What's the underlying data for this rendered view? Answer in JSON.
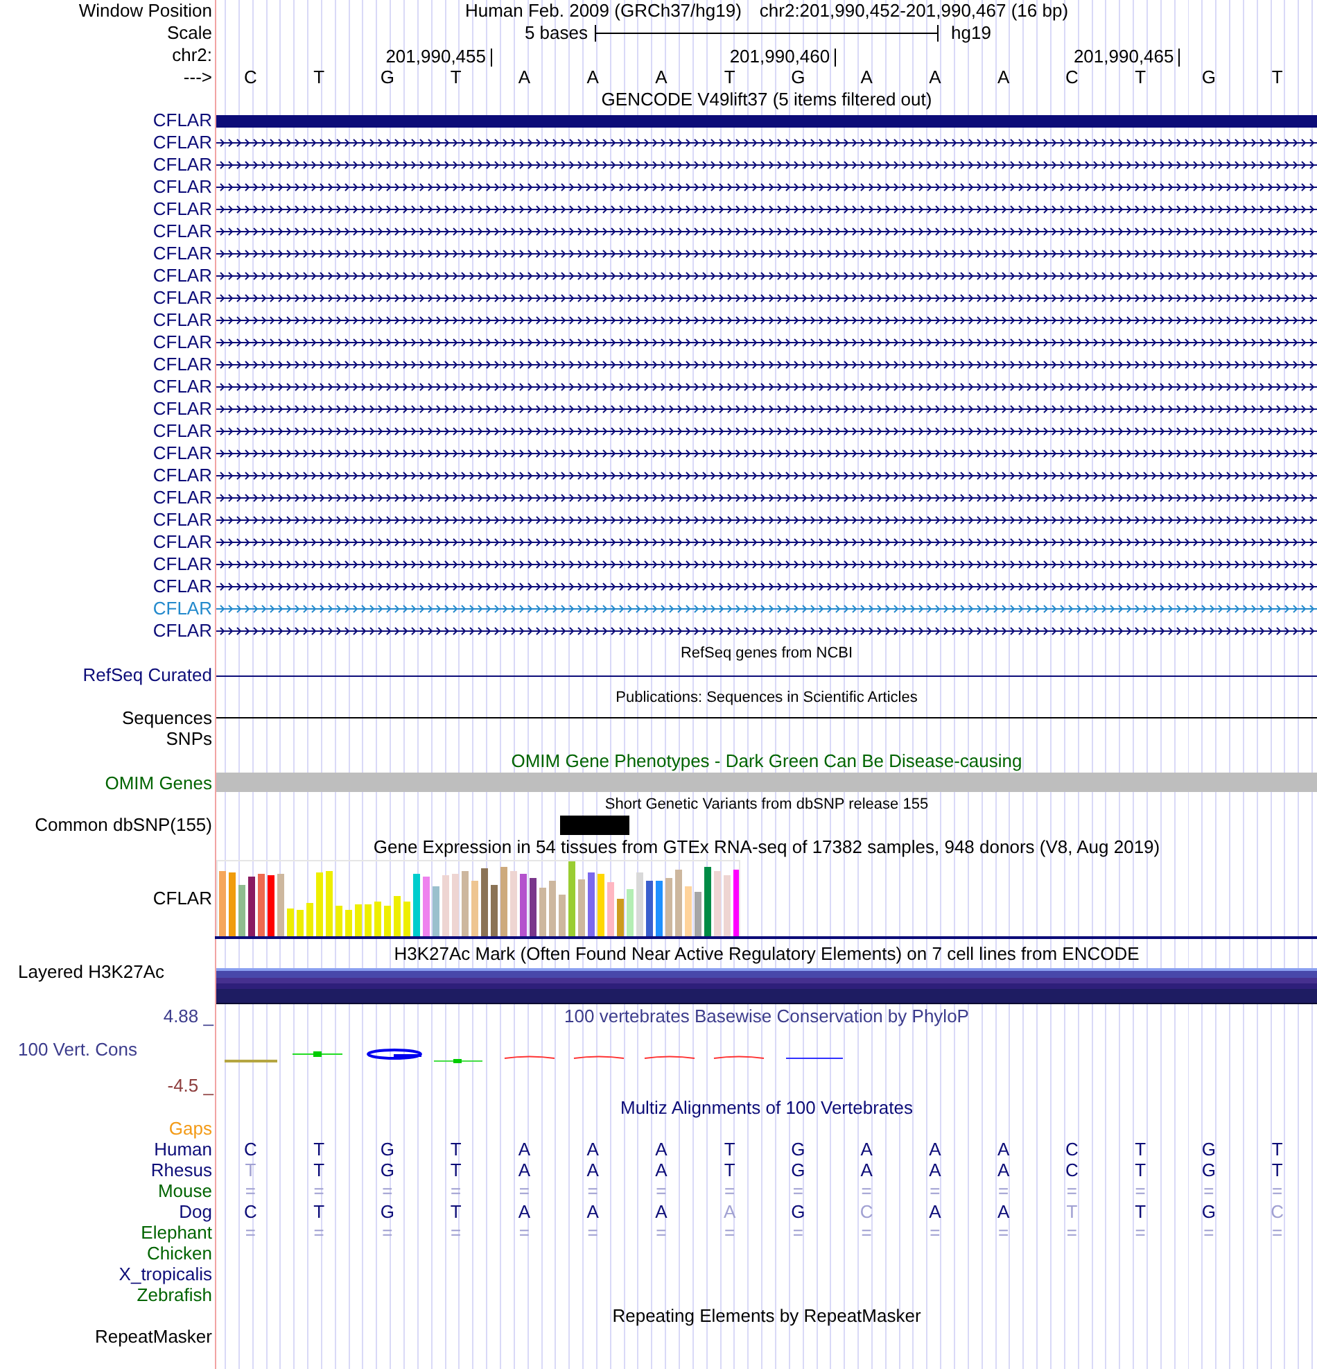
{
  "window_position": {
    "label": "Window Position",
    "assembly": "Human Feb. 2009 (GRCh37/hg19)",
    "range": "chr2:201,990,452-201,990,467 (16 bp)"
  },
  "scale": {
    "label": "Scale",
    "length": "5 bases",
    "assembly": "hg19"
  },
  "ruler": {
    "label": "chr2:",
    "ticks": [
      "201,990,455",
      "201,990,460",
      "201,990,465"
    ]
  },
  "sequence": {
    "label": "--->",
    "bases": [
      "C",
      "T",
      "G",
      "T",
      "A",
      "A",
      "A",
      "T",
      "G",
      "A",
      "A",
      "A",
      "C",
      "T",
      "G",
      "T"
    ]
  },
  "gencode": {
    "title": "GENCODE V49lift37 (5 items filtered out)",
    "items": [
      {
        "label": "CFLAR",
        "color": "#0c0c78",
        "kind": "exon"
      },
      {
        "label": "CFLAR",
        "color": "#0c0c78",
        "kind": "intron"
      },
      {
        "label": "CFLAR",
        "color": "#0c0c78",
        "kind": "intron"
      },
      {
        "label": "CFLAR",
        "color": "#0c0c78",
        "kind": "intron"
      },
      {
        "label": "CFLAR",
        "color": "#0c0c78",
        "kind": "intron"
      },
      {
        "label": "CFLAR",
        "color": "#0c0c78",
        "kind": "intron"
      },
      {
        "label": "CFLAR",
        "color": "#0c0c78",
        "kind": "intron"
      },
      {
        "label": "CFLAR",
        "color": "#0c0c78",
        "kind": "intron"
      },
      {
        "label": "CFLAR",
        "color": "#0c0c78",
        "kind": "intron"
      },
      {
        "label": "CFLAR",
        "color": "#0c0c78",
        "kind": "intron"
      },
      {
        "label": "CFLAR",
        "color": "#0c0c78",
        "kind": "intron"
      },
      {
        "label": "CFLAR",
        "color": "#0c0c78",
        "kind": "intron"
      },
      {
        "label": "CFLAR",
        "color": "#0c0c78",
        "kind": "intron"
      },
      {
        "label": "CFLAR",
        "color": "#0c0c78",
        "kind": "intron"
      },
      {
        "label": "CFLAR",
        "color": "#0c0c78",
        "kind": "intron"
      },
      {
        "label": "CFLAR",
        "color": "#0c0c78",
        "kind": "intron"
      },
      {
        "label": "CFLAR",
        "color": "#0c0c78",
        "kind": "intron"
      },
      {
        "label": "CFLAR",
        "color": "#0c0c78",
        "kind": "intron"
      },
      {
        "label": "CFLAR",
        "color": "#0c0c78",
        "kind": "intron"
      },
      {
        "label": "CFLAR",
        "color": "#0c0c78",
        "kind": "intron"
      },
      {
        "label": "CFLAR",
        "color": "#0c0c78",
        "kind": "intron"
      },
      {
        "label": "CFLAR",
        "color": "#0c0c78",
        "kind": "intron"
      },
      {
        "label": "CFLAR",
        "color": "#2389cc",
        "kind": "intron"
      },
      {
        "label": "CFLAR",
        "color": "#0c0c78",
        "kind": "intron"
      }
    ]
  },
  "refseq": {
    "title": "RefSeq genes from NCBI",
    "label": "RefSeq Curated"
  },
  "publications": {
    "title": "Publications: Sequences in Scientific Articles",
    "labels": [
      "Sequences",
      "SNPs"
    ]
  },
  "omim": {
    "title": "OMIM Gene Phenotypes - Dark Green Can Be Disease-causing",
    "label": "OMIM Genes"
  },
  "dbsnp": {
    "title": "Short Genetic Variants from dbSNP release 155",
    "label": "Common dbSNP(155)"
  },
  "gtex": {
    "title": "Gene Expression in 54 tissues from GTEx RNA-seq of 17382 samples, 948 donors (V8, Aug 2019)",
    "label": "CFLAR"
  },
  "h3k27ac": {
    "title": "H3K27Ac Mark (Often Found Near Active Regulatory Elements) on 7 cell lines from ENCODE",
    "label": "Layered H3K27Ac"
  },
  "phylop": {
    "title": "100 vertebrates Basewise Conservation by PhyloP",
    "label": "100 Vert. Cons",
    "axis_max": "4.88 _",
    "axis_min": "-4.5 _"
  },
  "multiz": {
    "title": "Multiz Alignments of 100 Vertebrates",
    "rows": [
      {
        "label": "Gaps",
        "color": "#f39a16"
      },
      {
        "label": "Human",
        "color": "#0c0c78",
        "bases": [
          {
            "base": "C",
            "faded": false
          },
          {
            "base": "T",
            "faded": false
          },
          {
            "base": "G",
            "faded": false
          },
          {
            "base": "T",
            "faded": false
          },
          {
            "base": "A",
            "faded": false
          },
          {
            "base": "A",
            "faded": false
          },
          {
            "base": "A",
            "faded": false
          },
          {
            "base": "T",
            "faded": false
          },
          {
            "base": "G",
            "faded": false
          },
          {
            "base": "A",
            "faded": false
          },
          {
            "base": "A",
            "faded": false
          },
          {
            "base": "A",
            "faded": false
          },
          {
            "base": "C",
            "faded": false
          },
          {
            "base": "T",
            "faded": false
          },
          {
            "base": "G",
            "faded": false
          },
          {
            "base": "T",
            "faded": false
          }
        ]
      },
      {
        "label": "Rhesus",
        "color": "#0c0c78",
        "bases": [
          {
            "base": "T",
            "faded": true
          },
          {
            "base": "T",
            "faded": false
          },
          {
            "base": "G",
            "faded": false
          },
          {
            "base": "T",
            "faded": false
          },
          {
            "base": "A",
            "faded": false
          },
          {
            "base": "A",
            "faded": false
          },
          {
            "base": "A",
            "faded": false
          },
          {
            "base": "T",
            "faded": false
          },
          {
            "base": "G",
            "faded": false
          },
          {
            "base": "A",
            "faded": false
          },
          {
            "base": "A",
            "faded": false
          },
          {
            "base": "A",
            "faded": false
          },
          {
            "base": "C",
            "faded": false
          },
          {
            "base": "T",
            "faded": false
          },
          {
            "base": "G",
            "faded": false
          },
          {
            "base": "T",
            "faded": false
          }
        ]
      },
      {
        "label": "Mouse",
        "color": "#006400",
        "bases": [
          {
            "base": "=",
            "faded": true
          },
          {
            "base": "=",
            "faded": true
          },
          {
            "base": "=",
            "faded": true
          },
          {
            "base": "=",
            "faded": true
          },
          {
            "base": "=",
            "faded": true
          },
          {
            "base": "=",
            "faded": true
          },
          {
            "base": "=",
            "faded": true
          },
          {
            "base": "=",
            "faded": true
          },
          {
            "base": "=",
            "faded": true
          },
          {
            "base": "=",
            "faded": true
          },
          {
            "base": "=",
            "faded": true
          },
          {
            "base": "=",
            "faded": true
          },
          {
            "base": "=",
            "faded": true
          },
          {
            "base": "=",
            "faded": true
          },
          {
            "base": "=",
            "faded": true
          },
          {
            "base": "=",
            "faded": true
          }
        ]
      },
      {
        "label": "Dog",
        "color": "#0c0c78",
        "bases": [
          {
            "base": "C",
            "faded": false
          },
          {
            "base": "T",
            "faded": false
          },
          {
            "base": "G",
            "faded": false
          },
          {
            "base": "T",
            "faded": false
          },
          {
            "base": "A",
            "faded": false
          },
          {
            "base": "A",
            "faded": false
          },
          {
            "base": "A",
            "faded": false
          },
          {
            "base": "A",
            "faded": true
          },
          {
            "base": "G",
            "faded": false
          },
          {
            "base": "C",
            "faded": true
          },
          {
            "base": "A",
            "faded": false
          },
          {
            "base": "A",
            "faded": false
          },
          {
            "base": "T",
            "faded": true
          },
          {
            "base": "T",
            "faded": false
          },
          {
            "base": "G",
            "faded": false
          },
          {
            "base": "C",
            "faded": true
          }
        ]
      },
      {
        "label": "Elephant",
        "color": "#006400",
        "bases": [
          {
            "base": "=",
            "faded": true
          },
          {
            "base": "=",
            "faded": true
          },
          {
            "base": "=",
            "faded": true
          },
          {
            "base": "=",
            "faded": true
          },
          {
            "base": "=",
            "faded": true
          },
          {
            "base": "=",
            "faded": true
          },
          {
            "base": "=",
            "faded": true
          },
          {
            "base": "=",
            "faded": true
          },
          {
            "base": "=",
            "faded": true
          },
          {
            "base": "=",
            "faded": true
          },
          {
            "base": "=",
            "faded": true
          },
          {
            "base": "=",
            "faded": true
          },
          {
            "base": "=",
            "faded": true
          },
          {
            "base": "=",
            "faded": true
          },
          {
            "base": "=",
            "faded": true
          },
          {
            "base": "=",
            "faded": true
          }
        ]
      },
      {
        "label": "Chicken",
        "color": "#006400"
      },
      {
        "label": "X_tropicalis",
        "color": "#0c0c78"
      },
      {
        "label": "Zebrafish",
        "color": "#006400"
      }
    ]
  },
  "repeatmasker": {
    "title": "Repeating Elements by RepeatMasker",
    "label": "RepeatMasker"
  }
}
